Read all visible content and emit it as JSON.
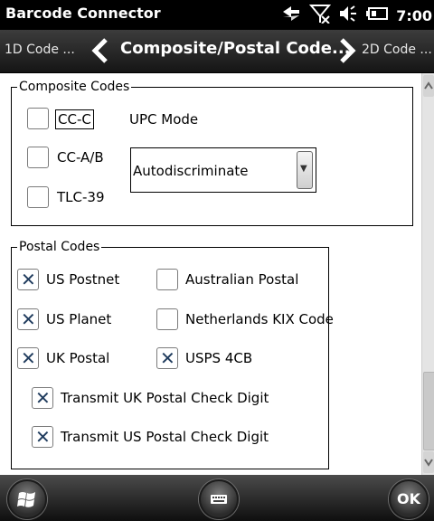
{
  "status": {
    "app_title": "Barcode Connector",
    "clock": "7:00"
  },
  "nav": {
    "prev_label": "1D Code ...",
    "current_label": "Composite/Postal Code...",
    "next_label": "2D Code ..."
  },
  "composite": {
    "legend": "Composite Codes",
    "items": [
      {
        "label": "CC-C",
        "checked": false
      },
      {
        "label": "CC-A/B",
        "checked": false
      },
      {
        "label": "TLC-39",
        "checked": false
      }
    ],
    "upc_mode_label": "UPC Mode",
    "upc_mode_value": "Autodiscriminate"
  },
  "postal": {
    "legend": "Postal Codes",
    "items": [
      {
        "label": "US Postnet",
        "checked": true
      },
      {
        "label": "Australian Postal",
        "checked": false
      },
      {
        "label": "US Planet",
        "checked": true
      },
      {
        "label": "Netherlands KIX Code",
        "checked": false
      },
      {
        "label": "UK Postal",
        "checked": true
      },
      {
        "label": "USPS 4CB",
        "checked": true
      },
      {
        "label": "Transmit UK Postal Check Digit",
        "checked": true
      },
      {
        "label": "Transmit US Postal Check Digit",
        "checked": true
      }
    ]
  },
  "bottom": {
    "ok_label": "OK"
  },
  "icons": [
    "signal-icon",
    "no-network-icon",
    "volume-icon",
    "battery-icon",
    "chevron-left-icon",
    "chevron-right-icon",
    "windows-start-icon",
    "keyboard-icon",
    "scroll-up-icon",
    "scroll-down-icon",
    "dropdown-arrow-icon"
  ]
}
